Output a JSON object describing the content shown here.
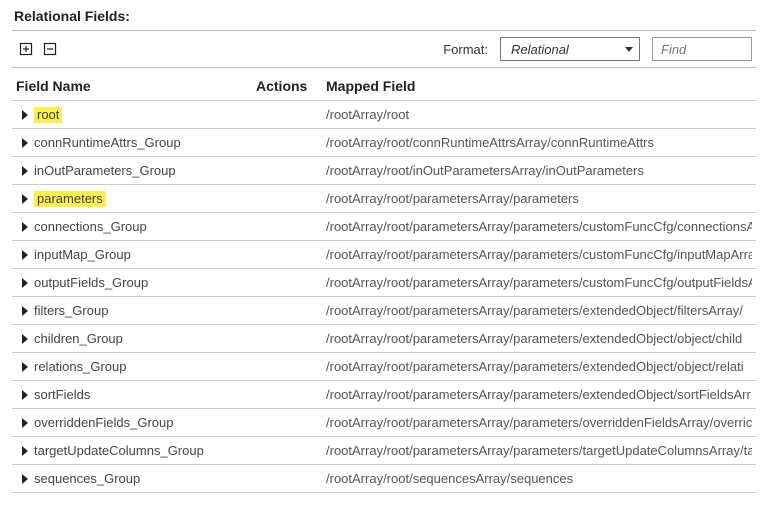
{
  "title": "Relational Fields:",
  "format": {
    "label": "Format:",
    "selected": "Relational"
  },
  "find": {
    "placeholder": "Find"
  },
  "columns": {
    "name": "Field Name",
    "actions": "Actions",
    "mapped": "Mapped Field"
  },
  "rows": [
    {
      "name": "root",
      "highlight": true,
      "mapped": "/rootArray/root"
    },
    {
      "name": "connRuntimeAttrs_Group",
      "highlight": false,
      "mapped": "/rootArray/root/connRuntimeAttrsArray/connRuntimeAttrs"
    },
    {
      "name": "inOutParameters_Group",
      "highlight": false,
      "mapped": "/rootArray/root/inOutParametersArray/inOutParameters"
    },
    {
      "name": "parameters",
      "highlight": true,
      "mapped": "/rootArray/root/parametersArray/parameters"
    },
    {
      "name": "connections_Group",
      "highlight": false,
      "mapped": "/rootArray/root/parametersArray/parameters/customFuncCfg/connectionsA"
    },
    {
      "name": "inputMap_Group",
      "highlight": false,
      "mapped": "/rootArray/root/parametersArray/parameters/customFuncCfg/inputMapArra"
    },
    {
      "name": "outputFields_Group",
      "highlight": false,
      "mapped": "/rootArray/root/parametersArray/parameters/customFuncCfg/outputFieldsA"
    },
    {
      "name": "filters_Group",
      "highlight": false,
      "mapped": "/rootArray/root/parametersArray/parameters/extendedObject/filtersArray/"
    },
    {
      "name": "children_Group",
      "highlight": false,
      "mapped": "/rootArray/root/parametersArray/parameters/extendedObject/object/child"
    },
    {
      "name": "relations_Group",
      "highlight": false,
      "mapped": "/rootArray/root/parametersArray/parameters/extendedObject/object/relati"
    },
    {
      "name": "sortFields",
      "highlight": false,
      "mapped": "/rootArray/root/parametersArray/parameters/extendedObject/sortFieldsArr"
    },
    {
      "name": "overriddenFields_Group",
      "highlight": false,
      "mapped": "/rootArray/root/parametersArray/parameters/overriddenFieldsArray/overric"
    },
    {
      "name": "targetUpdateColumns_Group",
      "highlight": false,
      "mapped": "/rootArray/root/parametersArray/parameters/targetUpdateColumnsArray/ta"
    },
    {
      "name": "sequences_Group",
      "highlight": false,
      "mapped": "/rootArray/root/sequencesArray/sequences"
    }
  ]
}
